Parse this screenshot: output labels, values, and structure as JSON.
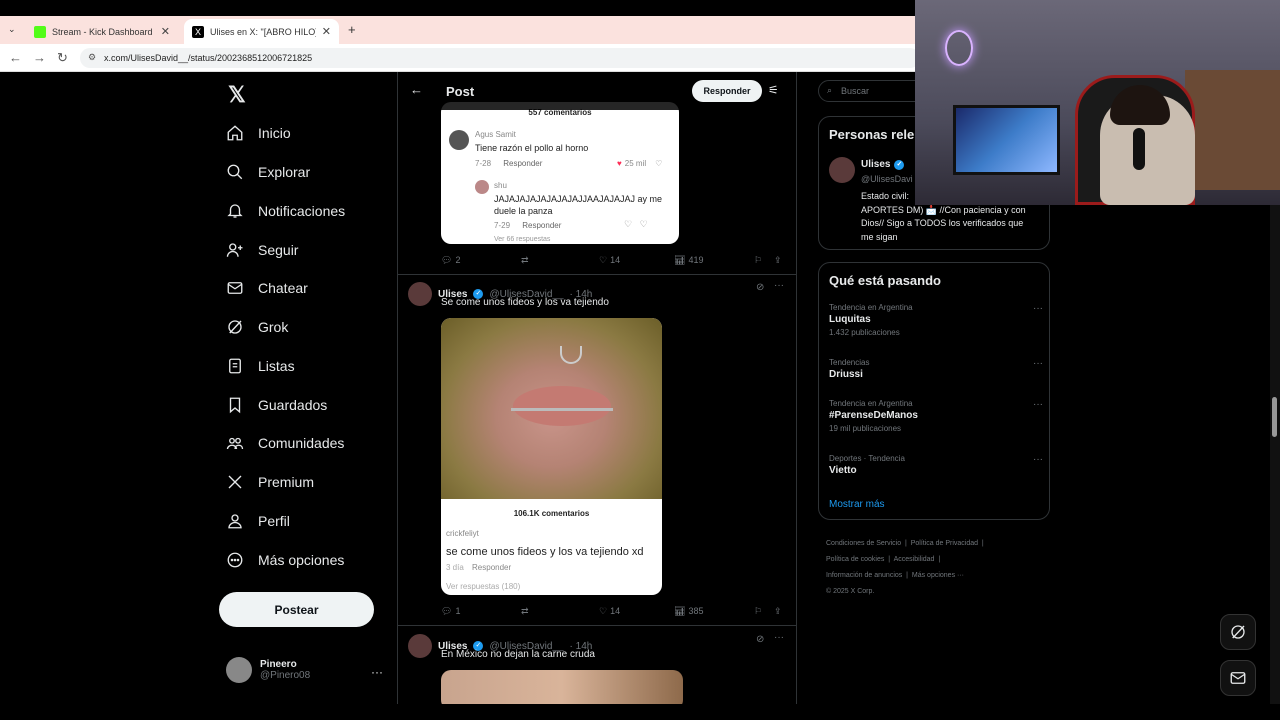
{
  "browser": {
    "tabs": [
      {
        "title": "Stream - Kick Dashboard",
        "active": false
      },
      {
        "title": "Ulises en X: \"[ABRO HILO] Mejo",
        "active": true
      }
    ],
    "url": "x.com/UlisesDavid__/status/2002368512006721825"
  },
  "leftnav": {
    "items": [
      {
        "label": "Inicio",
        "icon": "home-icon"
      },
      {
        "label": "Explorar",
        "icon": "search-icon"
      },
      {
        "label": "Notificaciones",
        "icon": "bell-icon"
      },
      {
        "label": "Seguir",
        "icon": "person-plus-icon"
      },
      {
        "label": "Chatear",
        "icon": "mail-icon"
      },
      {
        "label": "Grok",
        "icon": "grok-icon"
      },
      {
        "label": "Listas",
        "icon": "list-icon"
      },
      {
        "label": "Guardados",
        "icon": "bookmark-icon"
      },
      {
        "label": "Comunidades",
        "icon": "people-icon"
      },
      {
        "label": "Premium",
        "icon": "x-logo-icon"
      },
      {
        "label": "Perfil",
        "icon": "user-icon"
      },
      {
        "label": "Más opciones",
        "icon": "more-circle-icon"
      }
    ],
    "post_button": "Postear",
    "me": {
      "name": "Pineero",
      "handle": "@Pinero08"
    }
  },
  "header": {
    "title": "Post",
    "reply_button": "Responder"
  },
  "card1": {
    "comments_count": "557 comentarios",
    "c1_author": "Agus Samit",
    "c1_text": "Tiene razón el pollo al horno",
    "c1_meta": "7-28",
    "c1_reply": "Responder",
    "c1_likes": "25 mil",
    "c2_author": "shu",
    "c2_text": "JAJAJAJAJAJAJAJAJJAAJAJAJAJ ay me duele la panza",
    "c2_meta": "7-29",
    "c2_reply": "Responder",
    "more_replies": "Ver 66 respuestas"
  },
  "tweet1_actions": {
    "replies": "2",
    "likes": "14",
    "views": "419"
  },
  "tweet2": {
    "name": "Ulises",
    "handle": "@UlisesDavid__",
    "time": "· 14h",
    "text": "Se come unos fideos y los va tejiendo",
    "card_comments": "106.1K comentarios",
    "card_user": "crickfeliyt",
    "card_text": "se come unos fideos y los va tejiendo xd",
    "card_meta": "3 día",
    "card_reply": "Responder",
    "card_more": "Ver respuestas (180)",
    "replies": "1",
    "likes": "14",
    "views": "385"
  },
  "tweet3": {
    "name": "Ulises",
    "handle": "@UlisesDavid__",
    "time": "· 14h",
    "text": "En México no dejan la carne cruda"
  },
  "right": {
    "search_placeholder": "Buscar",
    "related_title": "Personas rele",
    "related_name": "Ulises",
    "related_handle": "@UlisesDavi",
    "related_bio_1": "Estado civil:",
    "related_bio_2": "APORTES DM) 📩 //Con paciencia y con",
    "related_bio_3": "Dios// Sigo a TODOS los verificados que",
    "related_bio_4": "me sigan",
    "trends_title": "Qué está pasando",
    "trends": [
      {
        "category": "Tendencia en Argentina",
        "name": "Luquitas",
        "count": "1.432 publicaciones"
      },
      {
        "category": "Tendencias",
        "name": "Driussi",
        "count": ""
      },
      {
        "category": "Tendencia en Argentina",
        "name": "#ParenseDeManos",
        "count": "19 mil publicaciones"
      },
      {
        "category": "Deportes · Tendencia",
        "name": "Vietto",
        "count": ""
      }
    ],
    "show_more": "Mostrar más",
    "footer": {
      "l1": "Condiciones de Servicio",
      "l2": "Política de Privacidad",
      "l3": "Política de cookies",
      "l4": "Accesibilidad",
      "l5": "Información de anuncios",
      "l6": "Más opciones ···",
      "l7": "© 2025 X Corp."
    }
  },
  "colors": {
    "accent": "#1d9bf0",
    "background": "#000000",
    "border": "#2f3336"
  }
}
